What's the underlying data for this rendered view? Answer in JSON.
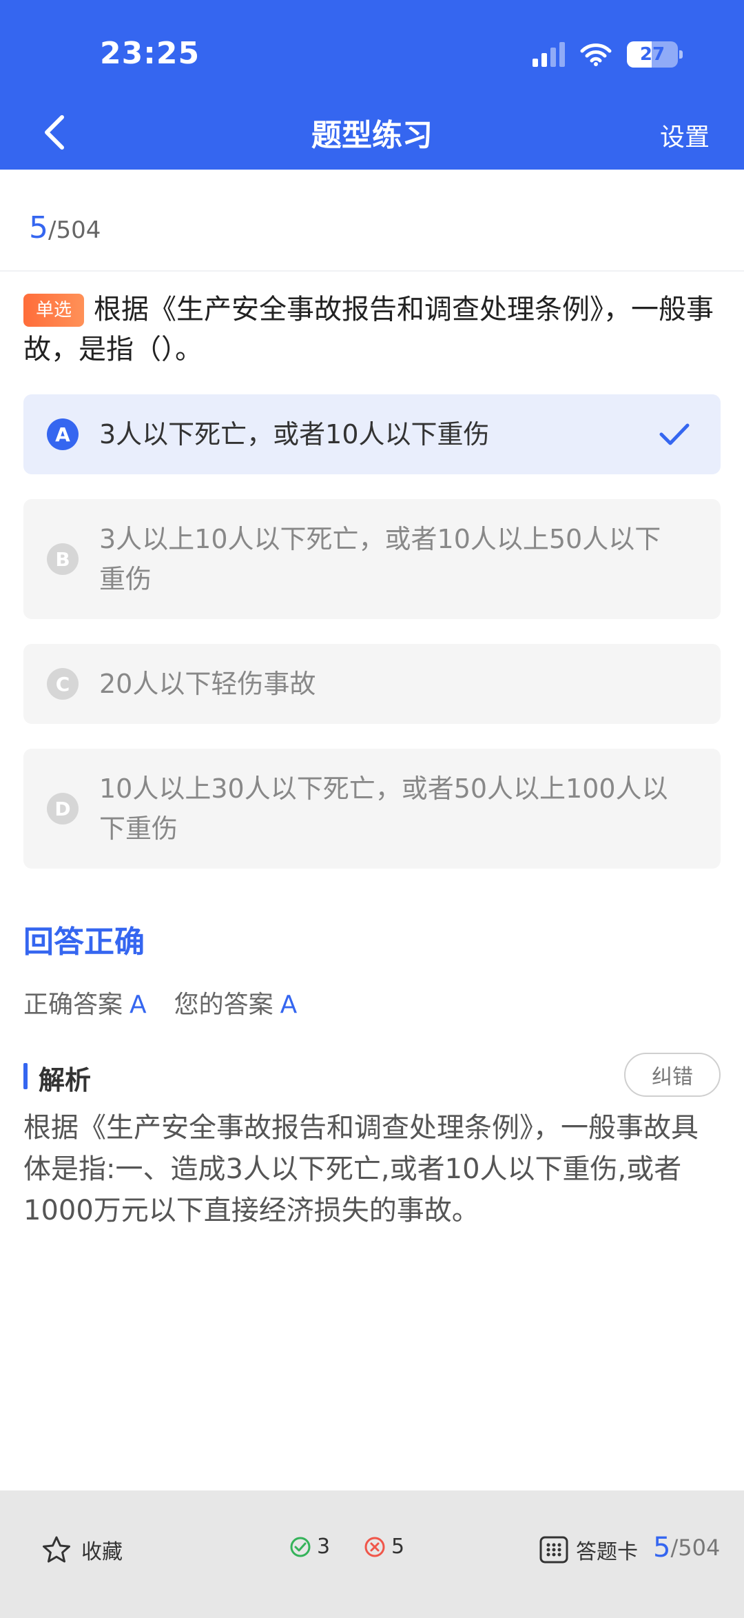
{
  "status_bar": {
    "time": "23:25",
    "battery": "27"
  },
  "header": {
    "title": "题型练习",
    "settings": "设置"
  },
  "progress": {
    "current": "5",
    "total": "/504"
  },
  "question": {
    "tag": "单选",
    "text": "根据《生产安全事故报告和调查处理条例》，一般事故，是指（）。"
  },
  "options": [
    {
      "letter": "A",
      "text": "3人以下死亡，或者10人以下重伤"
    },
    {
      "letter": "B",
      "text": "3人以上10人以下死亡，或者10人以上50人以下重伤"
    },
    {
      "letter": "C",
      "text": "20人以下轻伤事故"
    },
    {
      "letter": "D",
      "text": "10人以上30人以下死亡，或者50人以上100人以下重伤"
    }
  ],
  "result": {
    "title": "回答正确",
    "correct_label": "正确答案",
    "correct_value": "A",
    "your_label": "您的答案",
    "your_value": "A"
  },
  "analysis": {
    "title": "解析",
    "report_button": "纠错",
    "text": "根据《生产安全事故报告和调查处理条例》，一般事故具体是指:一、造成3人以下死亡,或者10人以下重伤,或者1000万元以下直接经济损失的事故。"
  },
  "bottom_bar": {
    "favorite": "收藏",
    "correct_count": "3",
    "wrong_count": "5",
    "answer_card": "答题卡",
    "current": "5",
    "total": "/504"
  },
  "colors": {
    "accent": "#3566f0",
    "tag": "#ff7a45",
    "correct": "#35b35a",
    "wrong": "#f0564a"
  }
}
